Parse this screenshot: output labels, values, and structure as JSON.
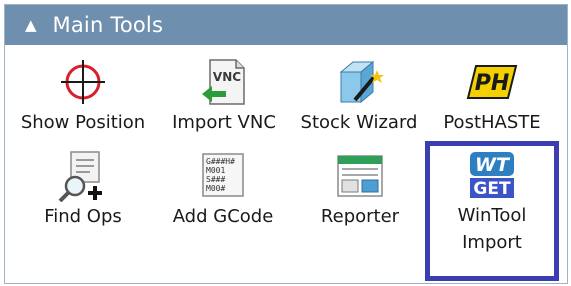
{
  "panel": {
    "title": "Main Tools",
    "caret_icon": "caret-up-icon",
    "header_color": "#6f8fae"
  },
  "tools": {
    "show_position": {
      "label": "Show Position",
      "icon": "crosshair-icon"
    },
    "import_vnc": {
      "label": "Import VNC",
      "icon": "vnc-import-icon",
      "icon_text": "VNC"
    },
    "stock_wizard": {
      "label": "Stock Wizard",
      "icon": "stock-wizard-icon"
    },
    "posthaste": {
      "label": "PostHASTE",
      "icon": "posthaste-icon",
      "icon_text": "PH"
    },
    "find_ops": {
      "label": "Find Ops",
      "icon": "find-ops-icon"
    },
    "add_gcode": {
      "label": "Add GCode",
      "icon": "gcode-icon",
      "icon_lines": [
        "G###H#",
        "M001",
        "S###",
        "M00#"
      ]
    },
    "reporter": {
      "label": "Reporter",
      "icon": "reporter-icon"
    },
    "wintool_import": {
      "label_line1": "WinTool",
      "label_line2": "Import",
      "icon": "wintool-get-icon",
      "icon_top": "WT",
      "icon_bottom": "GET"
    }
  },
  "highlight_color": "#3a3eb0"
}
